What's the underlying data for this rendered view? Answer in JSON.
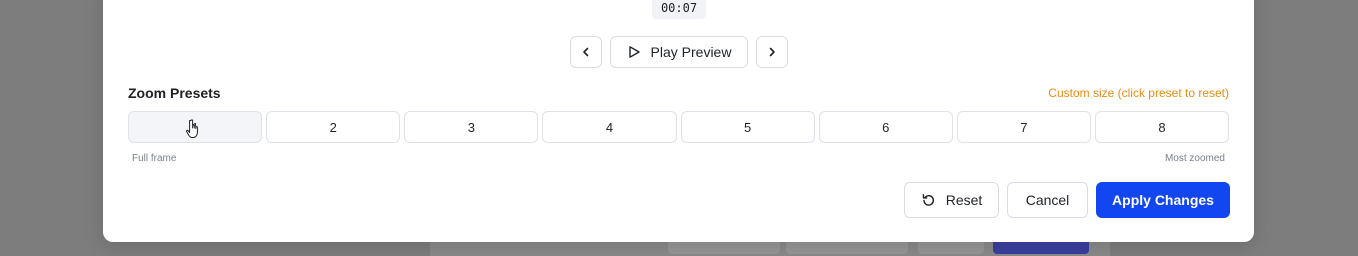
{
  "background": {
    "chips": [
      "",
      "",
      "",
      ""
    ]
  },
  "player": {
    "time": "00:07",
    "prev_icon": "chevron-left-icon",
    "play_icon": "play-icon",
    "play_label": "Play Preview",
    "next_icon": "chevron-right-icon"
  },
  "zoom": {
    "title": "Zoom Presets",
    "custom_note": "Custom size (click preset to reset)",
    "presets": [
      "1",
      "2",
      "3",
      "4",
      "5",
      "6",
      "7",
      "8"
    ],
    "selected_preset": "1",
    "hint_left": "Full frame",
    "hint_right": "Most zoomed"
  },
  "footer": {
    "reset_label": "Reset",
    "cancel_label": "Cancel",
    "apply_label": "Apply Changes"
  },
  "colors": {
    "accent": "#1246f0",
    "note": "#e98a14"
  }
}
